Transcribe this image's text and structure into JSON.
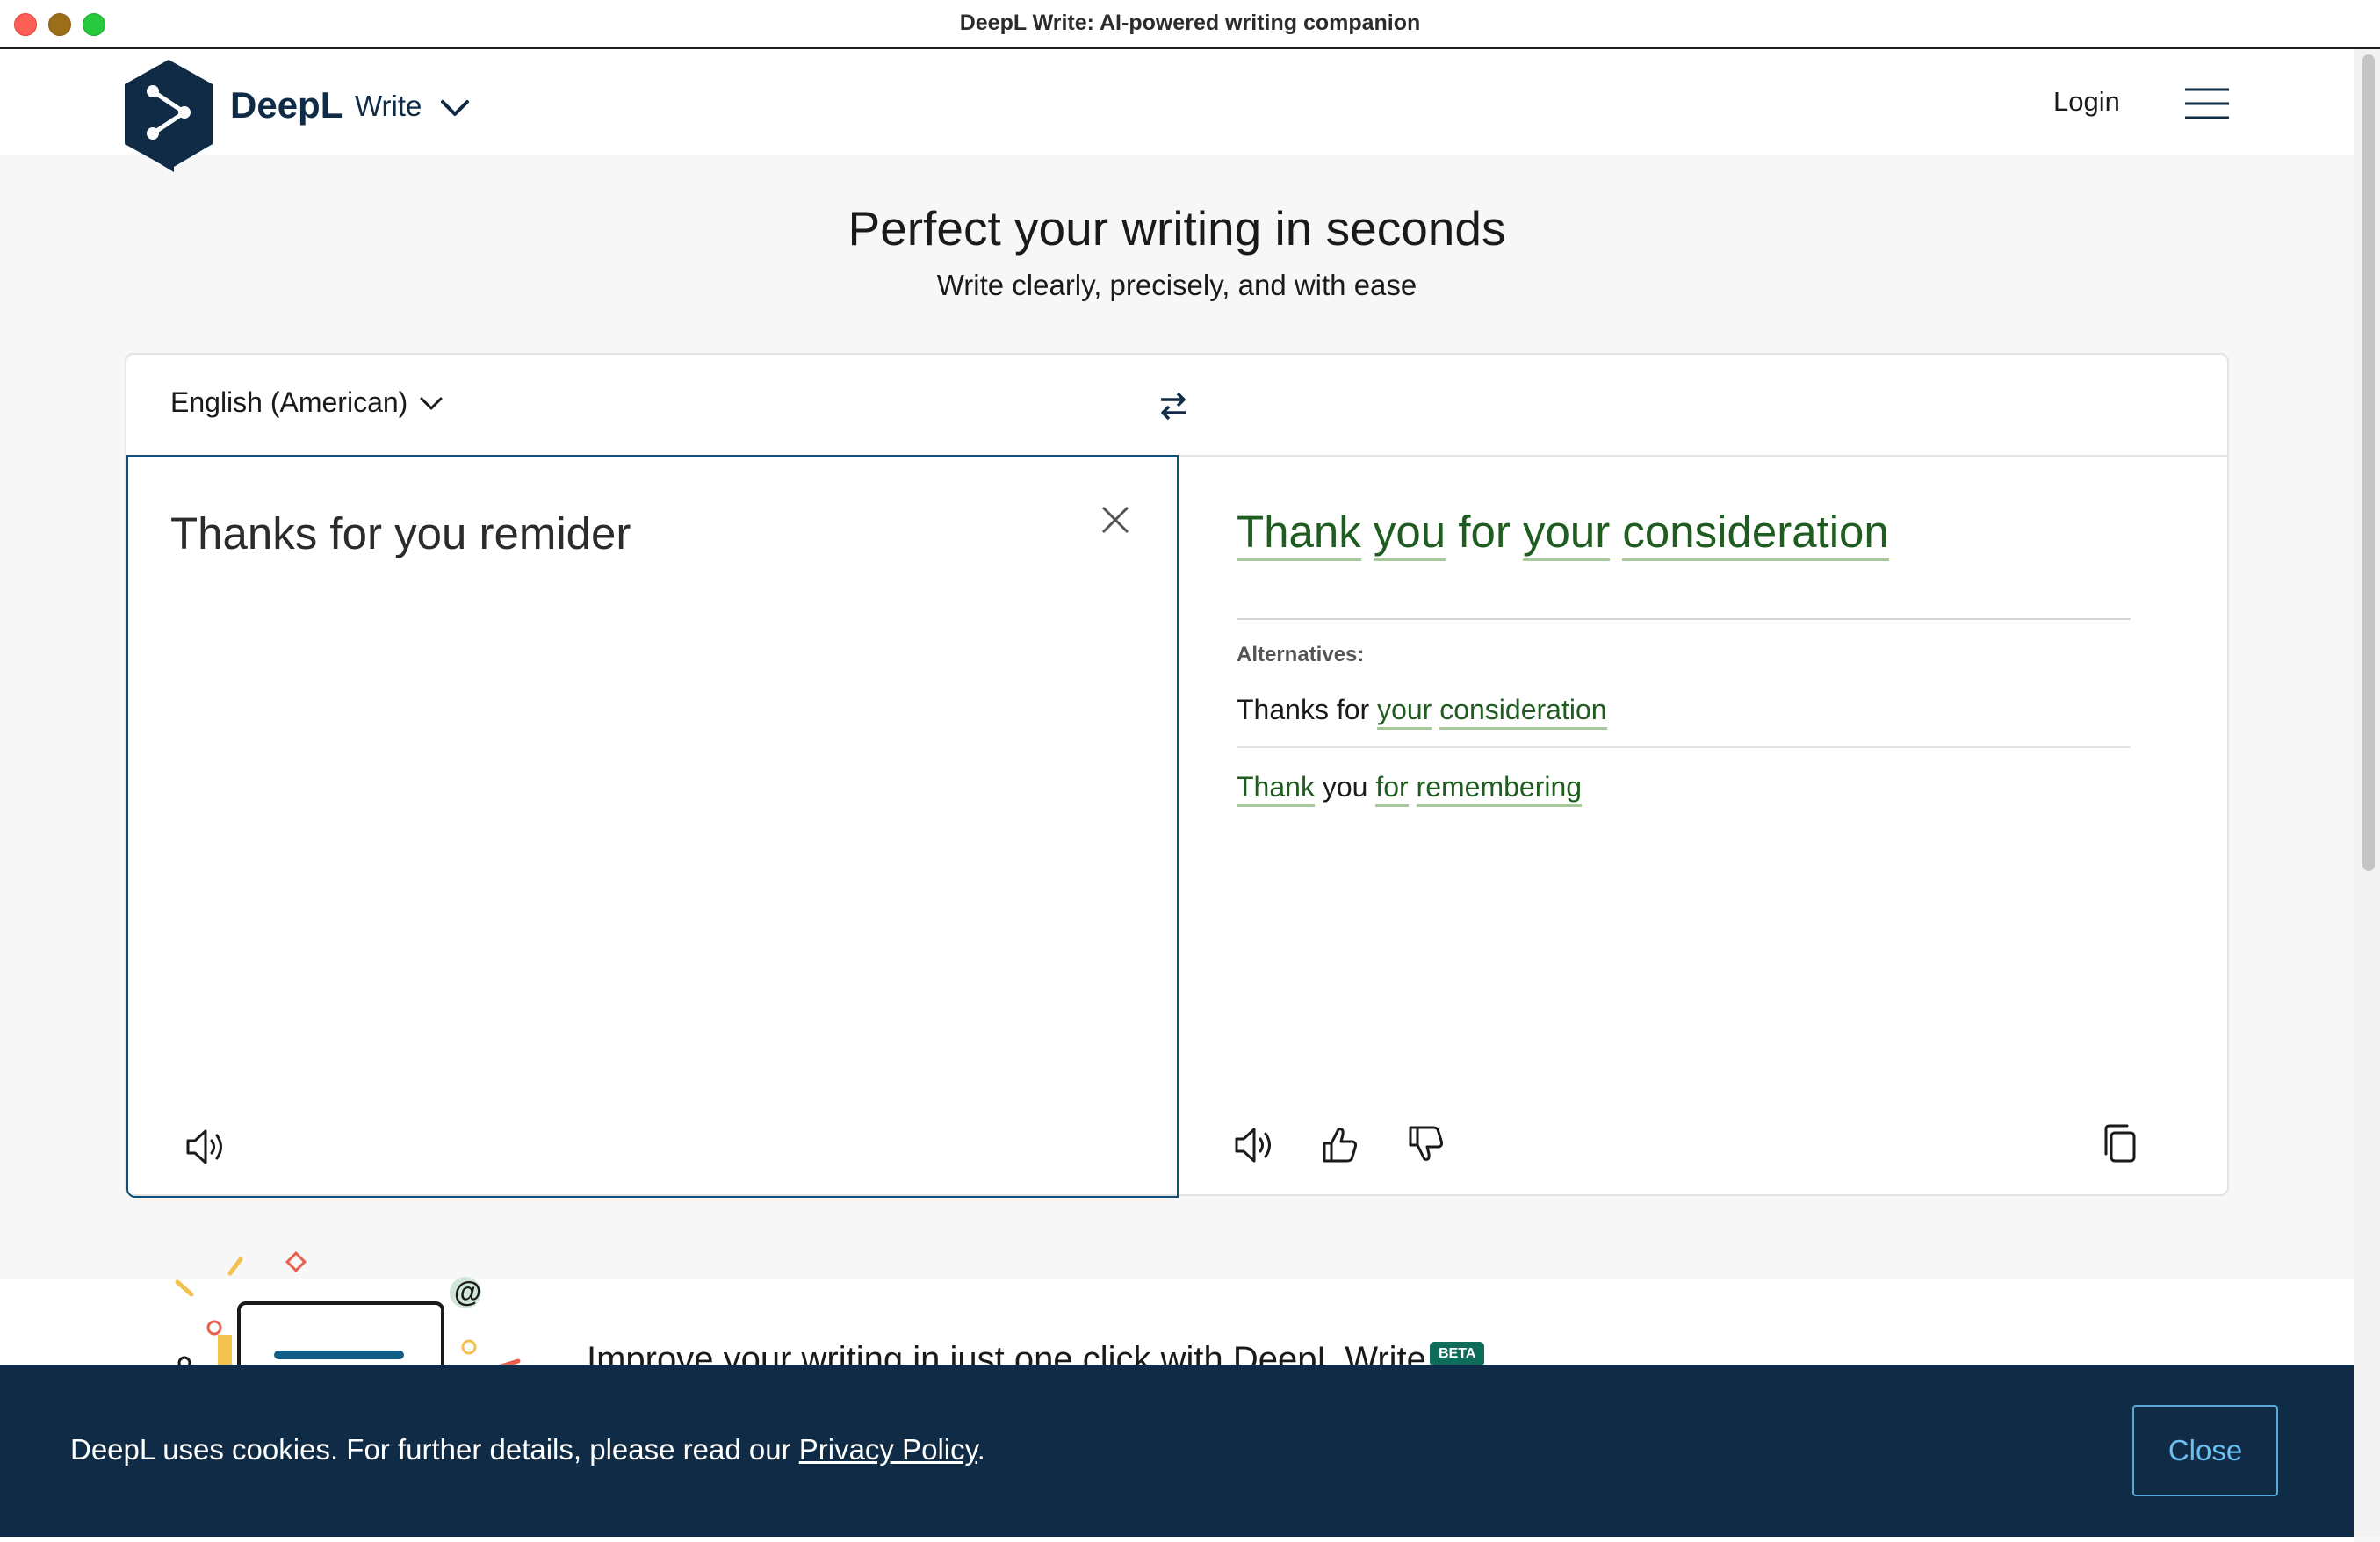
{
  "window": {
    "title": "DeepL Write: AI-powered writing companion"
  },
  "header": {
    "brand": "DeepL",
    "product": "Write",
    "login": "Login"
  },
  "hero": {
    "title": "Perfect your writing in seconds",
    "subtitle": "Write clearly, precisely, and with ease"
  },
  "editor": {
    "language": "English (American)",
    "input_text": "Thanks for you remider",
    "output": {
      "main": [
        {
          "text": "Thank",
          "changed": true
        },
        {
          "text": "you",
          "changed": true
        },
        {
          "text": "for",
          "changed": false
        },
        {
          "text": "your",
          "changed": true
        },
        {
          "text": "consideration",
          "changed": true
        }
      ],
      "alternatives_label": "Alternatives:",
      "alternatives": [
        [
          {
            "text": "Thanks",
            "changed": false
          },
          {
            "text": "for",
            "changed": false
          },
          {
            "text": "your",
            "changed": true
          },
          {
            "text": "consideration",
            "changed": true
          }
        ],
        [
          {
            "text": "Thank",
            "changed": true
          },
          {
            "text": "you",
            "changed": false
          },
          {
            "text": "for",
            "changed": true
          },
          {
            "text": "remembering",
            "changed": true
          }
        ]
      ]
    }
  },
  "promo": {
    "text": "Improve your writing in just one click with DeepL Write",
    "badge": "BETA"
  },
  "cookie": {
    "text_before": "DeepL uses cookies. For further details, please read our ",
    "link": "Privacy Policy",
    "text_after": ".",
    "close": "Close"
  },
  "colors": {
    "brand_navy": "#0f2b46",
    "suggestion_green": "#1f5c1f",
    "accent_blue": "#0f4f7a",
    "beta_teal": "#0f6b5a"
  },
  "icons": [
    "deepl-logo-icon",
    "chevron-down-icon",
    "menu-icon",
    "swap-icon",
    "close-icon",
    "speaker-icon",
    "thumbs-up-icon",
    "thumbs-down-icon",
    "copy-icon"
  ]
}
